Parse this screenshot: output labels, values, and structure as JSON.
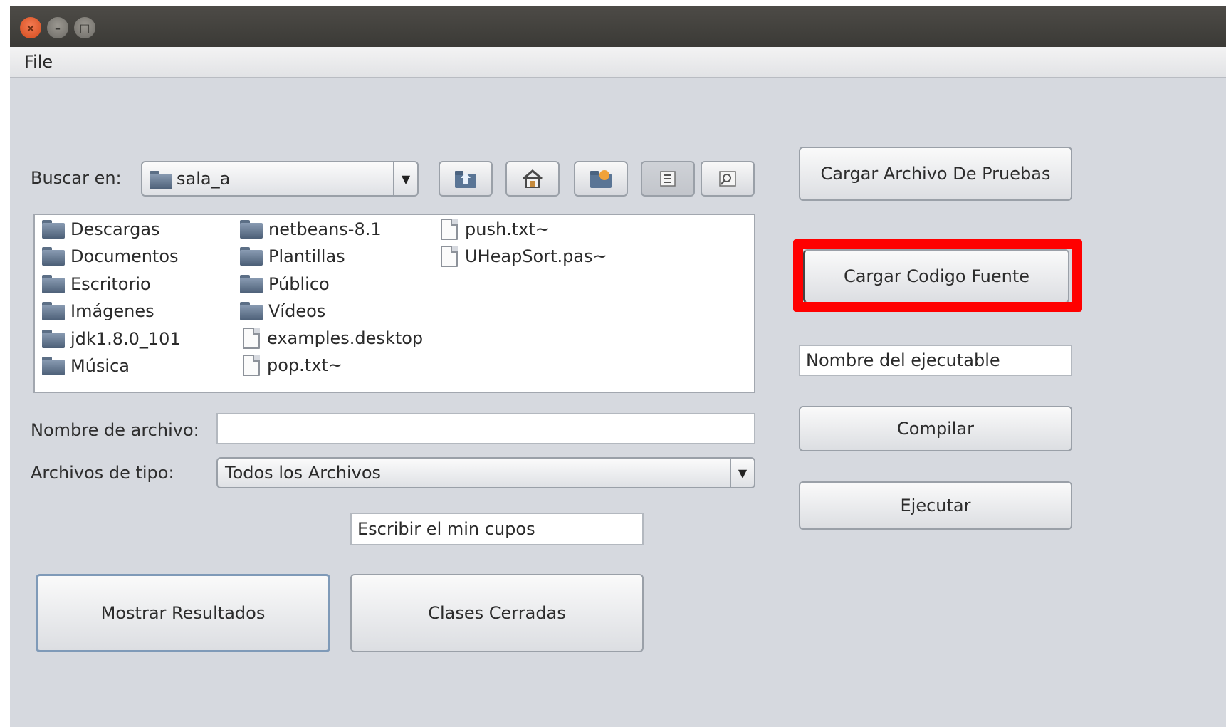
{
  "window": {
    "controls": {
      "close_icon": "×",
      "minimize_icon": "–",
      "maximize_icon": "□"
    }
  },
  "menubar": {
    "file": "File"
  },
  "chooser": {
    "look_in_label": "Buscar en:",
    "look_in_value": "sala_a",
    "toolbar_icons": [
      "up-folder-icon",
      "home-icon",
      "new-folder-icon",
      "list-view-icon",
      "details-view-icon"
    ],
    "files": [
      {
        "name": "Descargas",
        "type": "folder"
      },
      {
        "name": "Documentos",
        "type": "folder"
      },
      {
        "name": "Escritorio",
        "type": "folder"
      },
      {
        "name": "Imágenes",
        "type": "folder"
      },
      {
        "name": "jdk1.8.0_101",
        "type": "folder"
      },
      {
        "name": "Música",
        "type": "folder"
      },
      {
        "name": "netbeans-8.1",
        "type": "folder"
      },
      {
        "name": "Plantillas",
        "type": "folder"
      },
      {
        "name": "Público",
        "type": "folder"
      },
      {
        "name": "Vídeos",
        "type": "folder"
      },
      {
        "name": "examples.desktop",
        "type": "file"
      },
      {
        "name": "pop.txt~",
        "type": "file"
      },
      {
        "name": "push.txt~",
        "type": "file"
      },
      {
        "name": "UHeapSort.pas~",
        "type": "file"
      }
    ],
    "filename_label": "Nombre de archivo:",
    "filename_value": "",
    "filetype_label": "Archivos de tipo:",
    "filetype_value": "Todos los Archivos"
  },
  "min_cupos_field": "Escribir el min cupos",
  "buttons": {
    "mostrar_resultados": "Mostrar Resultados",
    "clases_cerradas": "Clases Cerradas",
    "cargar_pruebas": "Cargar Archivo De Pruebas",
    "cargar_codigo": "Cargar Codigo Fuente",
    "compilar": "Compilar",
    "ejecutar": "Ejecutar"
  },
  "ejecutable_field": "Nombre del ejecutable",
  "colors": {
    "highlight": "#ff0000",
    "window_bg": "#d6d9df",
    "titlebar": "#3f3d3a"
  }
}
